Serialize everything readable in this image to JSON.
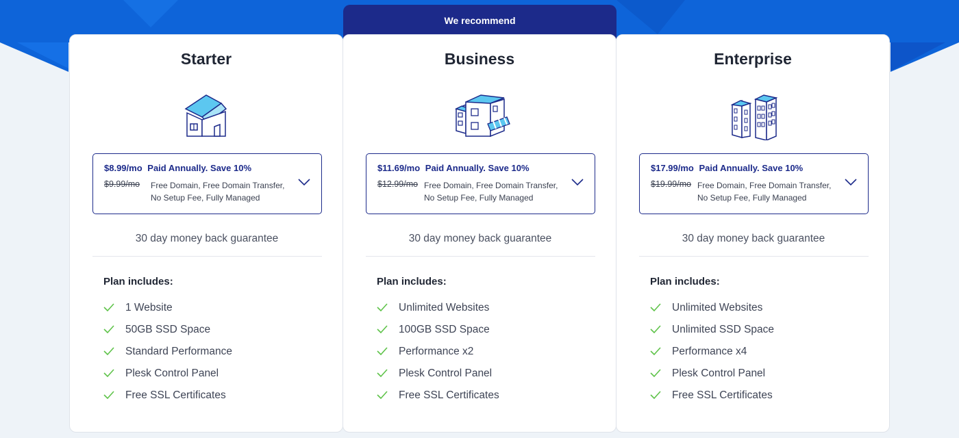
{
  "banner": {
    "recommend_label": "We recommend"
  },
  "colors": {
    "brand_blue": "#0c6fe0",
    "navy": "#1c2a8a",
    "check_green": "#5fc34a"
  },
  "plans": [
    {
      "name": "Starter",
      "icon": "house-icon",
      "price": "$8.99/mo",
      "paid_note": "Paid Annually. Save 10%",
      "old_price": "$9.99/mo",
      "perks": "Free Domain, Free Domain Transfer, No Setup Fee, Fully Managed",
      "guarantee": "30 day money back guarantee",
      "includes_title": "Plan includes:",
      "features": [
        "1 Website",
        "50GB SSD Space",
        "Standard Performance",
        "Plesk Control Panel",
        "Free SSL Certificates"
      ]
    },
    {
      "name": "Business",
      "icon": "shop-building-icon",
      "price": "$11.69/mo",
      "paid_note": "Paid Annually. Save 10%",
      "old_price": "$12.99/mo",
      "perks": "Free Domain, Free Domain Transfer, No Setup Fee, Fully Managed",
      "guarantee": "30 day money back guarantee",
      "includes_title": "Plan includes:",
      "features": [
        "Unlimited Websites",
        "100GB SSD Space",
        "Performance x2",
        "Plesk Control Panel",
        "Free SSL Certificates"
      ]
    },
    {
      "name": "Enterprise",
      "icon": "office-buildings-icon",
      "price": "$17.99/mo",
      "paid_note": "Paid Annually. Save 10%",
      "old_price": "$19.99/mo",
      "perks": "Free Domain, Free Domain Transfer, No Setup Fee, Fully Managed",
      "guarantee": "30 day money back guarantee",
      "includes_title": "Plan includes:",
      "features": [
        "Unlimited Websites",
        "Unlimited SSD Space",
        "Performance x4",
        "Plesk Control Panel",
        "Free SSL Certificates"
      ]
    }
  ]
}
